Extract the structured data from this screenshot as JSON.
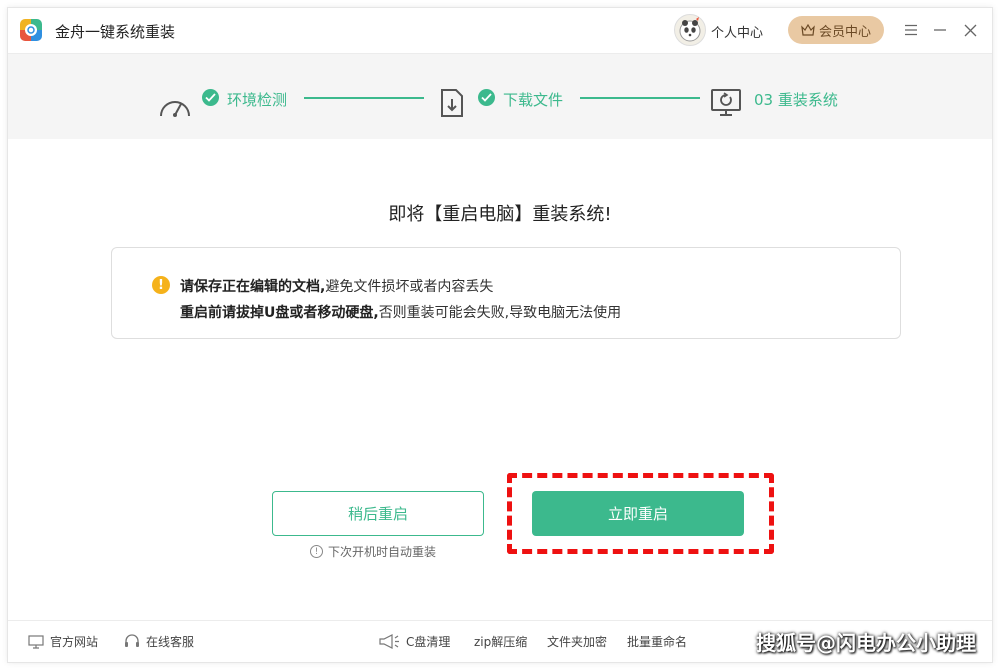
{
  "app": {
    "title": "金舟一键系统重装"
  },
  "header": {
    "personal_center": "个人中心",
    "vip_center": "会员中心"
  },
  "steps": [
    {
      "label": "环境检测",
      "status": "done"
    },
    {
      "label": "下载文件",
      "status": "done"
    },
    {
      "label": "03 重装系统",
      "status": "current"
    }
  ],
  "main": {
    "title": "即将【重启电脑】重装系统!",
    "notice": {
      "line1_bold": "请保存正在编辑的文档,",
      "line1_text": "避免文件损坏或者内容丢失",
      "line2_bold": "重启前请拔掉U盘或者移动硬盘,",
      "line2_text": "否则重装可能会失败,导致电脑无法使用"
    },
    "later_button": "稍后重启",
    "later_hint": "下次开机时自动重装",
    "now_button": "立即重启"
  },
  "footer": {
    "official_site": "官方网站",
    "online_service": "在线客服",
    "c_clean": "C盘清理",
    "zip": "zip解压缩",
    "folder_encrypt": "文件夹加密",
    "batch_rename": "批量重命名",
    "watermark": "搜狐号@闪电办公小助理"
  },
  "colors": {
    "accent": "#3cb98d",
    "warning": "#f5b21b",
    "vip": "#e9c9a3",
    "highlight": "#ee1111"
  }
}
